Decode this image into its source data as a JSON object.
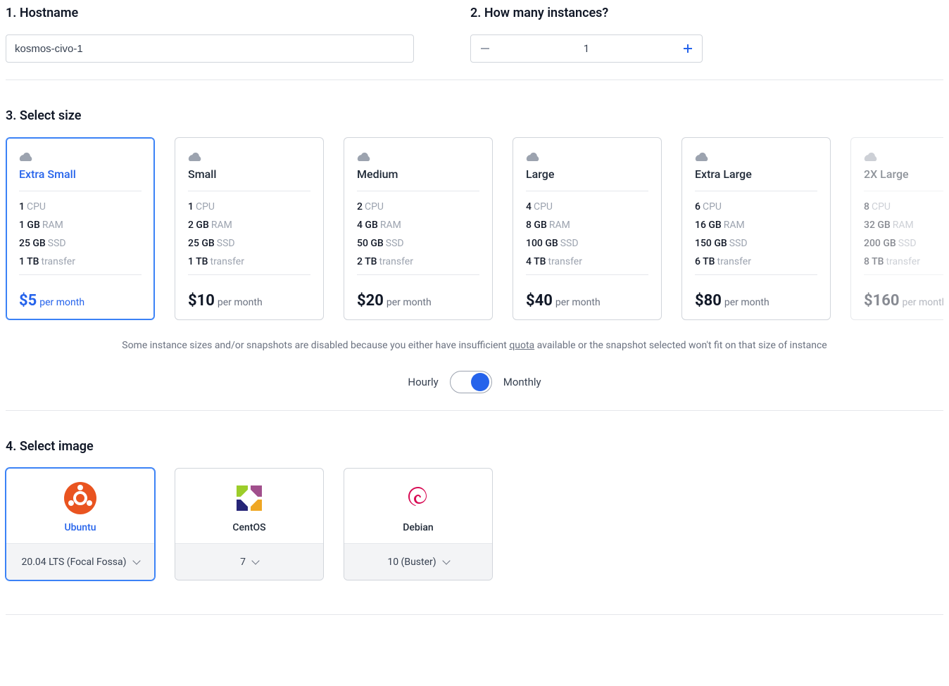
{
  "hostname": {
    "heading": "1. Hostname",
    "value": "kosmos-civo-1"
  },
  "instances": {
    "heading": "2. How many instances?",
    "value": "1"
  },
  "size": {
    "heading": "3. Select size",
    "quota_note_pre": "Some instance sizes and/or snapshots are disabled because you either have insufficient ",
    "quota_link": "quota",
    "quota_note_post": " available or the snapshot selected won't fit on that size of instance",
    "hourly_label": "Hourly",
    "monthly_label": "Monthly",
    "per_month": "per month",
    "cpu_label": "CPU",
    "ram_label": "RAM",
    "ssd_label": "SSD",
    "transfer_label": "transfer",
    "cards": [
      {
        "name": "Extra Small",
        "cpu": "1",
        "ram": "1 GB",
        "ssd": "25 GB",
        "transfer": "1 TB",
        "price": "$5",
        "selected": true,
        "disabled": false
      },
      {
        "name": "Small",
        "cpu": "1",
        "ram": "2 GB",
        "ssd": "25 GB",
        "transfer": "1 TB",
        "price": "$10",
        "selected": false,
        "disabled": false
      },
      {
        "name": "Medium",
        "cpu": "2",
        "ram": "4 GB",
        "ssd": "50 GB",
        "transfer": "2 TB",
        "price": "$20",
        "selected": false,
        "disabled": false
      },
      {
        "name": "Large",
        "cpu": "4",
        "ram": "8 GB",
        "ssd": "100 GB",
        "transfer": "4 TB",
        "price": "$40",
        "selected": false,
        "disabled": false
      },
      {
        "name": "Extra Large",
        "cpu": "6",
        "ram": "16 GB",
        "ssd": "150 GB",
        "transfer": "6 TB",
        "price": "$80",
        "selected": false,
        "disabled": false
      },
      {
        "name": "2X Large",
        "cpu": "8",
        "ram": "32 GB",
        "ssd": "200 GB",
        "transfer": "8 TB",
        "price": "$160",
        "selected": false,
        "disabled": true
      }
    ]
  },
  "image": {
    "heading": "4. Select image",
    "cards": [
      {
        "name": "Ubuntu",
        "version": "20.04 LTS (Focal Fossa)",
        "selected": true,
        "logo_color": "#e95420"
      },
      {
        "name": "CentOS",
        "version": "7",
        "selected": false,
        "logo_color": "#a14f8c"
      },
      {
        "name": "Debian",
        "version": "10 (Buster)",
        "selected": false,
        "logo_color": "#d70a53"
      }
    ]
  }
}
